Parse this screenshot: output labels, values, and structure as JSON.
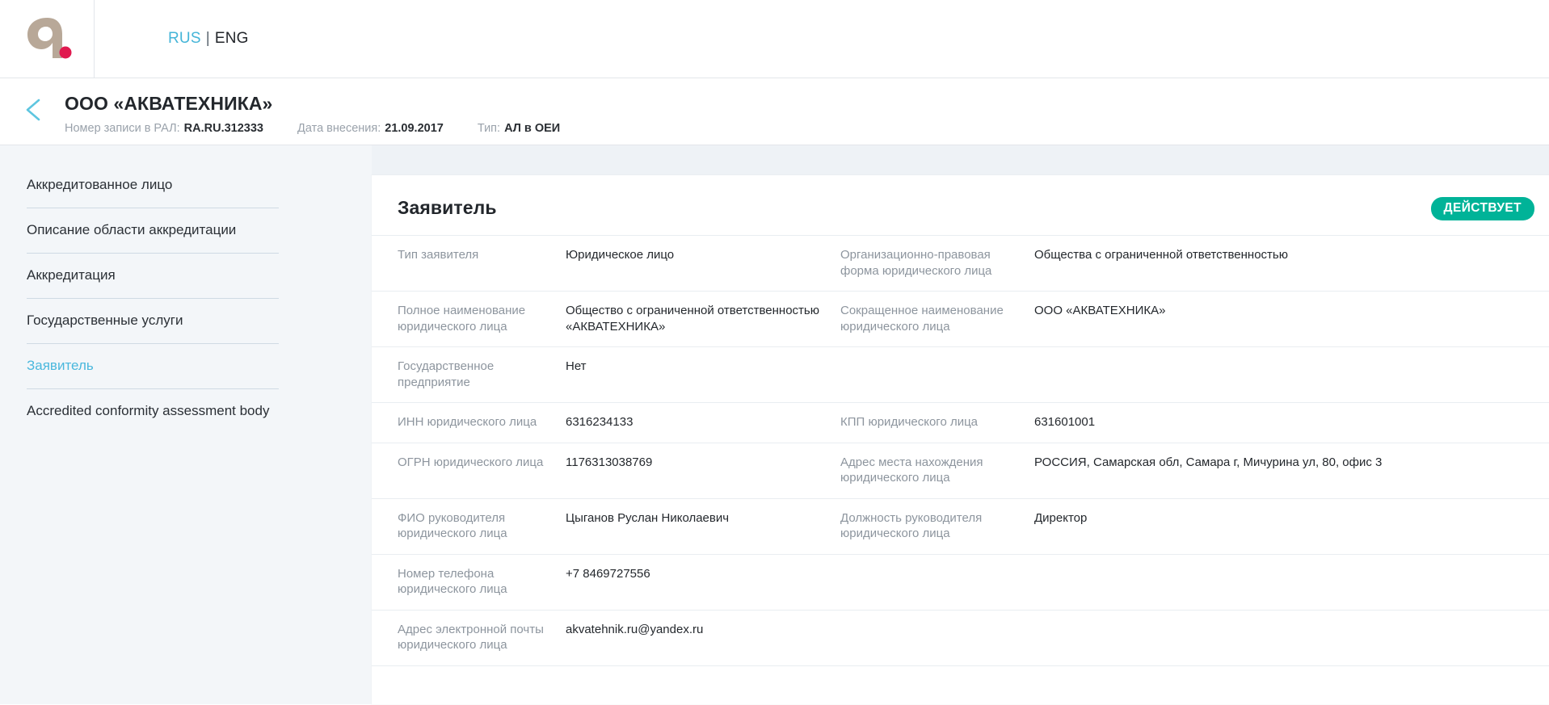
{
  "topbar": {
    "logo_name": "fsa-rosaccreditation-logo",
    "languages": {
      "rus": "RUS",
      "separator": "|",
      "eng": "ENG",
      "active": "RUS",
      "active_color": "#45b5d8"
    }
  },
  "page_head": {
    "back_icon": "chevron-left-icon",
    "back_icon_color": "#5ec6e0",
    "title": "ООО «АКВАТЕХНИКА»",
    "meta": [
      {
        "label": "Номер записи в РАЛ:",
        "value": "RA.RU.312333"
      },
      {
        "label": "Дата внесения:",
        "value": "21.09.2017"
      },
      {
        "label": "Тип:",
        "value": "АЛ в ОЕИ"
      }
    ]
  },
  "sidebar": {
    "items": [
      {
        "label": "Аккредитованное лицо",
        "active": false
      },
      {
        "label": "Описание области аккредитации",
        "active": false
      },
      {
        "label": "Аккредитация",
        "active": false
      },
      {
        "label": "Государственные услуги",
        "active": false
      },
      {
        "label": "Заявитель",
        "active": true
      },
      {
        "label": "Accredited conformity assessment body",
        "active": false
      }
    ],
    "active_color": "#4bb8dd"
  },
  "card": {
    "title": "Заявитель",
    "status": {
      "label": "ДЕЙСТВУЕТ",
      "color": "#00b398",
      "text_color": "#ffffff"
    },
    "rows": [
      {
        "label1": "Тип заявителя",
        "value1": "Юридическое лицо",
        "label2": "Организационно-правовая форма юридического лица",
        "value2": "Общества с ограниченной ответственностью"
      },
      {
        "label1": "Полное наименование юридического лица",
        "value1": "Общество с ограниченной ответственностью «АКВАТЕХНИКА»",
        "label2": "Сокращенное наименование юридического лица",
        "value2": "ООО «АКВАТЕХНИКА»"
      },
      {
        "label1": "Государственное предприятие",
        "value1": "Нет",
        "label2": "",
        "value2": ""
      },
      {
        "label1": "ИНН юридического лица",
        "value1": "6316234133",
        "label2": "КПП юридического лица",
        "value2": "631601001"
      },
      {
        "label1": "ОГРН юридического лица",
        "value1": "1176313038769",
        "label2": "Адрес места нахождения юридического лица",
        "value2": "РОССИЯ, Самарская обл, Самара г, Мичурина ул, 80, офис 3"
      },
      {
        "label1": "ФИО руководителя юридического лица",
        "value1": "Цыганов Руслан Николаевич",
        "label2": "Должность руководителя юридического лица",
        "value2": "Директор"
      },
      {
        "label1": "Номер телефона юридического лица",
        "value1": "+7 8469727556",
        "label2": "",
        "value2": ""
      },
      {
        "label1": "Адрес электронной почты юридического лица",
        "value1": "akvatehnik.ru@yandex.ru",
        "label2": "",
        "value2": ""
      }
    ]
  }
}
